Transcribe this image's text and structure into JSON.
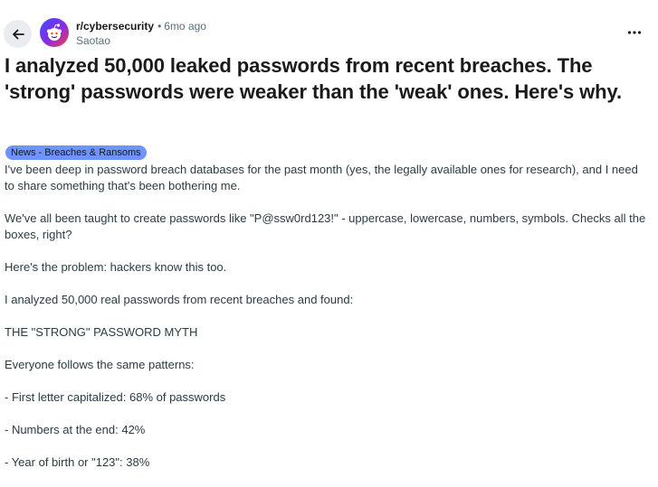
{
  "post": {
    "subreddit": "r/cybersecurity",
    "separator": "•",
    "time": "6mo ago",
    "author": "Saotao",
    "title": "I analyzed 50,000 leaked passwords from recent breaches. The 'strong' passwords were weaker than the 'weak' ones. Here's why.",
    "flair": "News - Breaches & Ransoms",
    "paragraphs": [
      "I've been deep in password breach databases for the past month (yes, the legally available ones for research), and I need to share something that's been bothering me.",
      "We've all been taught to create passwords like \"P@ssw0rd123!\" - uppercase, lowercase, numbers, symbols. Checks all the boxes, right?",
      "Here's the problem: hackers know this too.",
      "I analyzed 50,000 real passwords from recent breaches and found:",
      "THE \"STRONG\" PASSWORD MYTH",
      "Everyone follows the same patterns:",
      "- First letter capitalized: 68% of passwords",
      "- Numbers at the end: 42%",
      "- Year of birth or \"123\": 38%"
    ]
  },
  "icons": {
    "back": "arrow-left-icon",
    "more": "more-horizontal-icon",
    "avatar": "reddit-snoo-icon"
  },
  "colors": {
    "flair_bg": "#7193ff",
    "back_bg": "#eaedef"
  }
}
